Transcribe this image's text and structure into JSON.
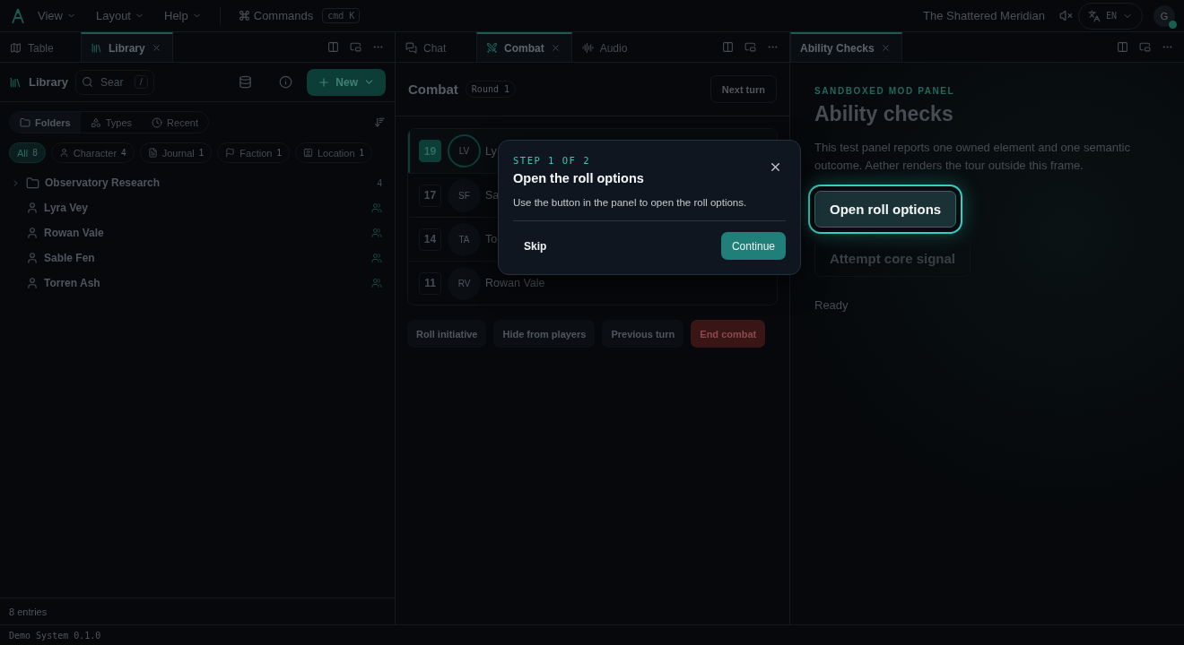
{
  "menubar": {
    "menus": [
      {
        "label": "View"
      },
      {
        "label": "Layout"
      },
      {
        "label": "Help"
      }
    ],
    "commands": {
      "label": "Commands",
      "shortcut": "cmd K"
    },
    "campaign": "The Shattered Meridian",
    "language": "EN",
    "avatar": "G"
  },
  "library_pane": {
    "tabs": [
      {
        "label": "Table",
        "selected": false
      },
      {
        "label": "Library",
        "selected": true
      }
    ],
    "title": "Library",
    "search": {
      "placeholder": "Sear",
      "shortcut": "/"
    },
    "new_button": "New",
    "views": [
      {
        "label": "Folders",
        "selected": true
      },
      {
        "label": "Types",
        "selected": false
      },
      {
        "label": "Recent",
        "selected": false
      }
    ],
    "filters": [
      {
        "label": "All",
        "count": "8",
        "selected": true
      },
      {
        "label": "Character",
        "count": "4",
        "selected": false
      },
      {
        "label": "Journal",
        "count": "1",
        "selected": false
      },
      {
        "label": "Faction",
        "count": "1",
        "selected": false
      },
      {
        "label": "Location",
        "count": "1",
        "selected": false
      }
    ],
    "entries": [
      {
        "kind": "folder",
        "label": "Observatory Research",
        "count": "4",
        "expanded": false
      },
      {
        "kind": "character",
        "label": "Lyra Vey"
      },
      {
        "kind": "character",
        "label": "Rowan Vale"
      },
      {
        "kind": "character",
        "label": "Sable Fen"
      },
      {
        "kind": "character",
        "label": "Torren Ash"
      }
    ],
    "footer": "8 entries"
  },
  "combat_pane": {
    "tabs": [
      {
        "label": "Chat",
        "selected": false
      },
      {
        "label": "Combat",
        "selected": true
      },
      {
        "label": "Audio",
        "selected": false
      }
    ],
    "title": "Combat",
    "round": "Round 1",
    "next_button": "Next turn",
    "combatants": [
      {
        "initiative": "19",
        "initials": "LV",
        "name": "Ly",
        "selected": true
      },
      {
        "initiative": "17",
        "initials": "SF",
        "name": "Sa",
        "selected": false
      },
      {
        "initiative": "14",
        "initials": "TA",
        "name": "To",
        "selected": false
      },
      {
        "initiative": "11",
        "initials": "RV",
        "name": "Rowan Vale",
        "selected": false
      }
    ],
    "actions": [
      {
        "label": "Roll initiative",
        "kind": "default"
      },
      {
        "label": "Hide from players",
        "kind": "default"
      },
      {
        "label": "Previous turn",
        "kind": "default"
      },
      {
        "label": "End combat",
        "kind": "danger"
      }
    ]
  },
  "mod_pane": {
    "tabs": [
      {
        "label": "Ability Checks",
        "selected": true
      }
    ],
    "eyebrow": "SANDBOXED MOD PANEL",
    "title": "Ability checks",
    "description": "This test panel reports one owned element and one semantic outcome. Aether renders the tour outside this frame.",
    "buttons": [
      {
        "label": "Open roll options",
        "highlighted": true,
        "disabled": false
      },
      {
        "label": "Attempt core signal",
        "highlighted": false,
        "disabled": true
      }
    ],
    "status": "Ready"
  },
  "tour": {
    "step": "STEP 1 OF 2",
    "title": "Open the roll options",
    "body": "Use the button in the panel to open the roll options.",
    "skip": "Skip",
    "continue": "Continue"
  },
  "status_bar": {
    "text": "Demo System 0.1.0"
  }
}
